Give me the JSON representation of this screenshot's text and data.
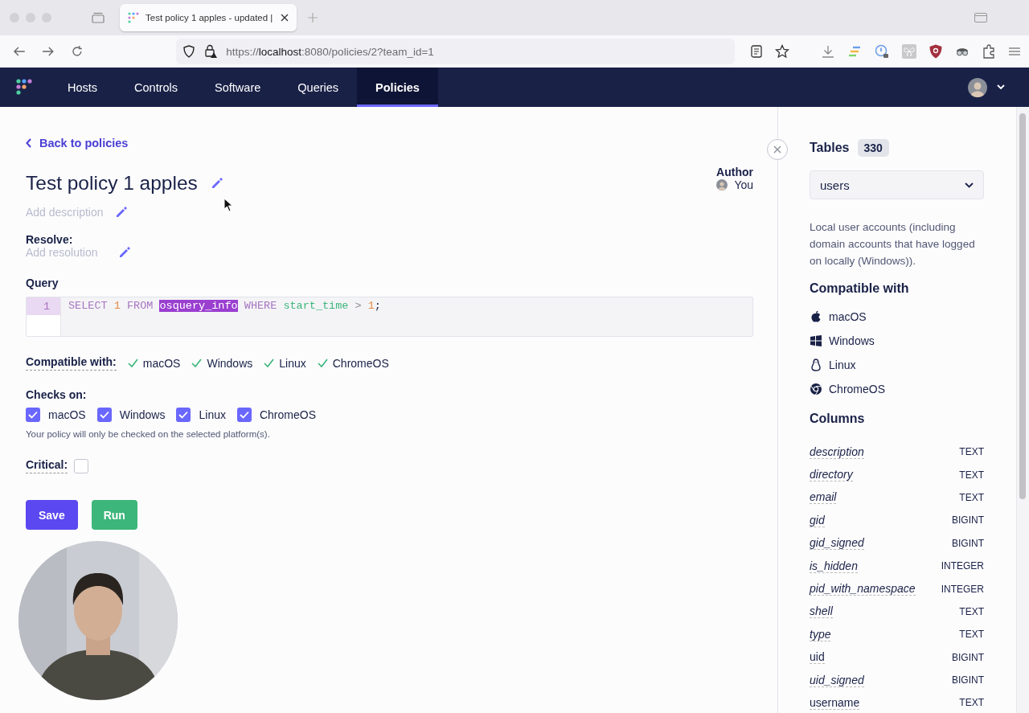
{
  "browser": {
    "tab_title": "Test policy 1 apples - updated |",
    "url": "https://**localhost**:8080/policies/2?team_id=1"
  },
  "nav": {
    "items": [
      {
        "label": "Hosts",
        "selected": false
      },
      {
        "label": "Controls",
        "selected": false
      },
      {
        "label": "Software",
        "selected": false
      },
      {
        "label": "Queries",
        "selected": false
      },
      {
        "label": "Policies",
        "selected": true
      }
    ]
  },
  "editor": {
    "back_link": "Back to policies",
    "title": "Test policy 1 apples",
    "author_label": "Author",
    "author_name": "You",
    "description_placeholder": "Add description",
    "resolve_label": "Resolve:",
    "resolution_placeholder": "Add resolution",
    "query_label": "Query",
    "query": {
      "line_number": "1",
      "tokens": [
        {
          "text": "SELECT",
          "kind": "keyword",
          "selected": false
        },
        {
          "text": "1",
          "kind": "number",
          "selected": false
        },
        {
          "text": "FROM",
          "kind": "keyword",
          "selected": false
        },
        {
          "text": "osquery_info",
          "kind": "table",
          "selected": true
        },
        {
          "text": "WHERE",
          "kind": "keyword",
          "selected": false
        },
        {
          "text": "start_time",
          "kind": "column",
          "selected": false
        },
        {
          "text": ">",
          "kind": "operator",
          "selected": false
        },
        {
          "text": "1",
          "kind": "number",
          "selected": false
        },
        {
          "text": ";",
          "kind": "punct",
          "selected": false
        }
      ]
    },
    "compatible_label": "Compatible with:",
    "compatible": [
      "macOS",
      "Windows",
      "Linux",
      "ChromeOS"
    ],
    "checks_label": "Checks on:",
    "checks": [
      {
        "label": "macOS",
        "checked": true
      },
      {
        "label": "Windows",
        "checked": true
      },
      {
        "label": "Linux",
        "checked": true
      },
      {
        "label": "ChromeOS",
        "checked": true
      }
    ],
    "checks_hint": "Your policy will only be checked on the selected platform(s).",
    "critical_label": "Critical:",
    "critical": false,
    "buttons": [
      {
        "label": "Save",
        "kind": "primary"
      },
      {
        "label": "Run",
        "kind": "run"
      }
    ]
  },
  "sidebar": {
    "title": "Tables",
    "count": "330",
    "selected_table": "users",
    "description": "Local user accounts (including domain accounts that have logged on locally (Windows)).",
    "compatible_title": "Compatible with",
    "platforms": [
      {
        "label": "macOS",
        "kind": "apple"
      },
      {
        "label": "Windows",
        "kind": "windows"
      },
      {
        "label": "Linux",
        "kind": "linux"
      },
      {
        "label": "ChromeOS",
        "kind": "chrome"
      }
    ],
    "columns_title": "Columns",
    "columns": [
      {
        "name": "description",
        "type": "TEXT",
        "italic": true
      },
      {
        "name": "directory",
        "type": "TEXT",
        "italic": true
      },
      {
        "name": "email",
        "type": "TEXT",
        "italic": true
      },
      {
        "name": "gid",
        "type": "BIGINT",
        "italic": true
      },
      {
        "name": "gid_signed",
        "type": "BIGINT",
        "italic": true
      },
      {
        "name": "is_hidden",
        "type": "INTEGER",
        "italic": true
      },
      {
        "name": "pid_with_namespace",
        "type": "INTEGER",
        "italic": true
      },
      {
        "name": "shell",
        "type": "TEXT",
        "italic": true
      },
      {
        "name": "type",
        "type": "TEXT",
        "italic": true
      },
      {
        "name": "uid",
        "type": "BIGINT",
        "italic": false
      },
      {
        "name": "uid_signed",
        "type": "BIGINT",
        "italic": true
      },
      {
        "name": "username",
        "type": "TEXT",
        "italic": false
      }
    ]
  }
}
